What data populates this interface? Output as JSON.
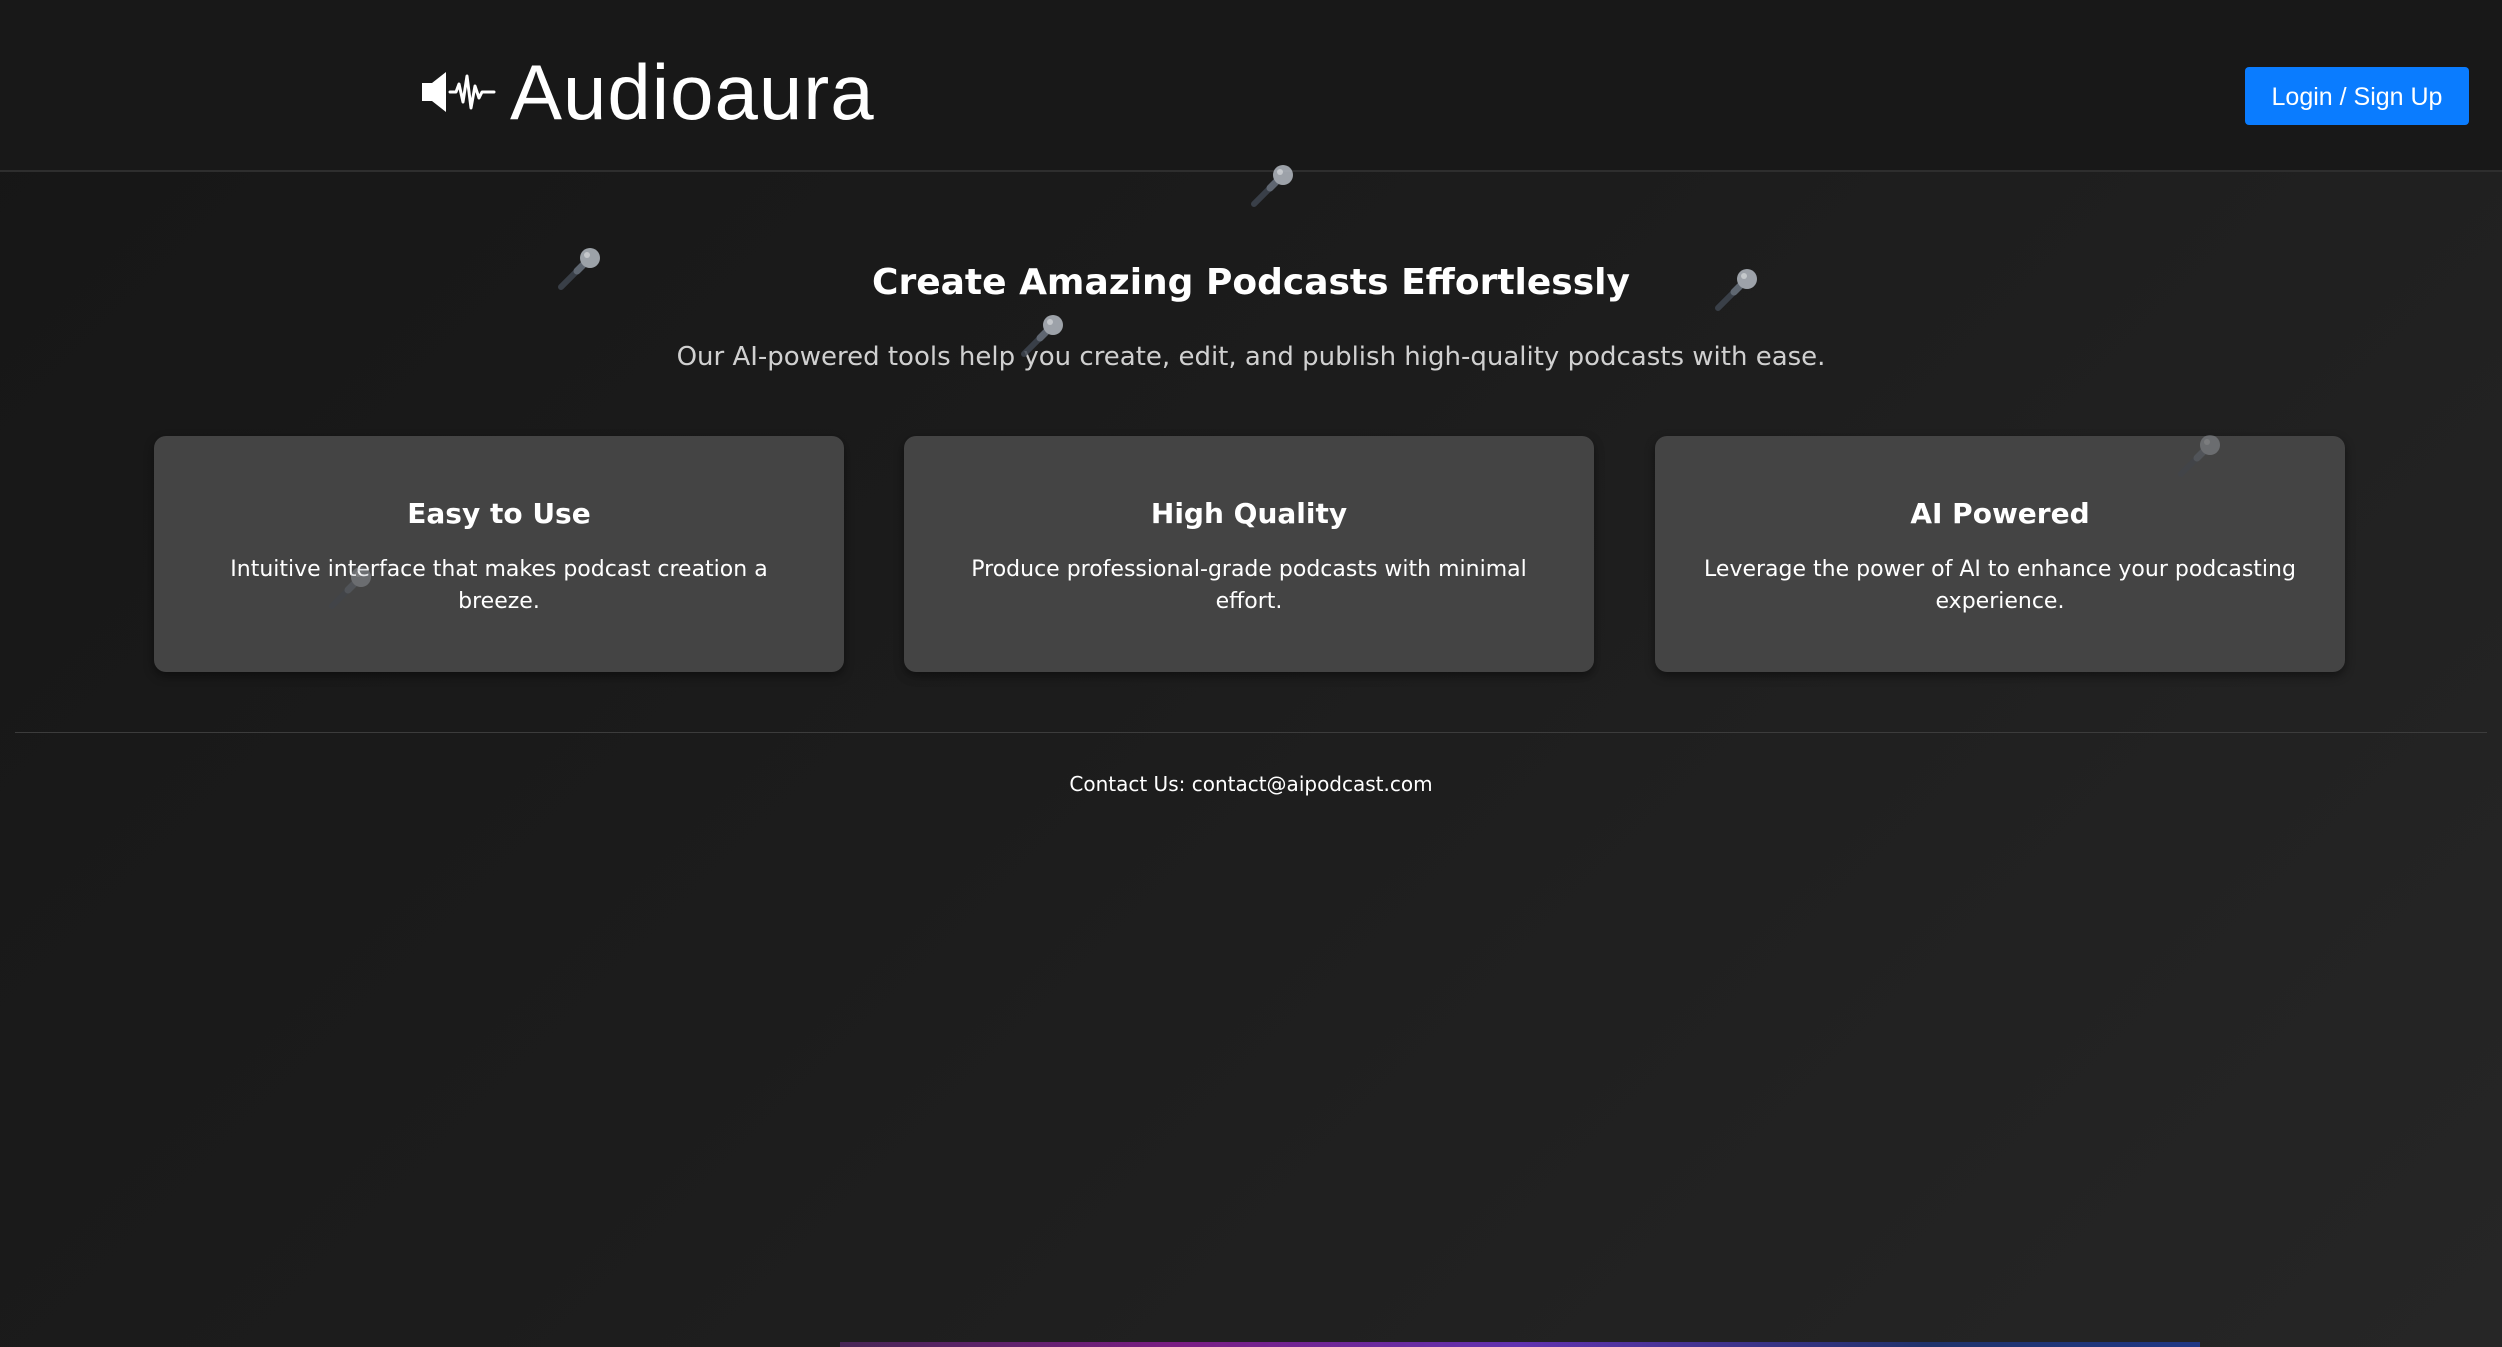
{
  "header": {
    "brand": "Audioaura",
    "login_label": "Login / Sign Up",
    "logo_icon": "speaker-waveform-icon"
  },
  "hero": {
    "title": "Create Amazing Podcasts Effortlessly",
    "subtitle": "Our AI-powered tools help you create, edit, and publish high-quality podcasts with ease."
  },
  "features": [
    {
      "title": "Easy to Use",
      "description": "Intuitive interface that makes podcast creation a breeze."
    },
    {
      "title": "High Quality",
      "description": "Produce professional-grade podcasts with minimal effort."
    },
    {
      "title": "AI Powered",
      "description": "Leverage the power of AI to enhance your podcasting experience."
    }
  ],
  "footer": {
    "contact": "Contact Us: contact@aipodcast.com"
  },
  "decorations": {
    "icon": "microphone-icon"
  },
  "colors": {
    "accent": "#0a7cff",
    "background": "#1c1c1c",
    "card": "#444444"
  }
}
